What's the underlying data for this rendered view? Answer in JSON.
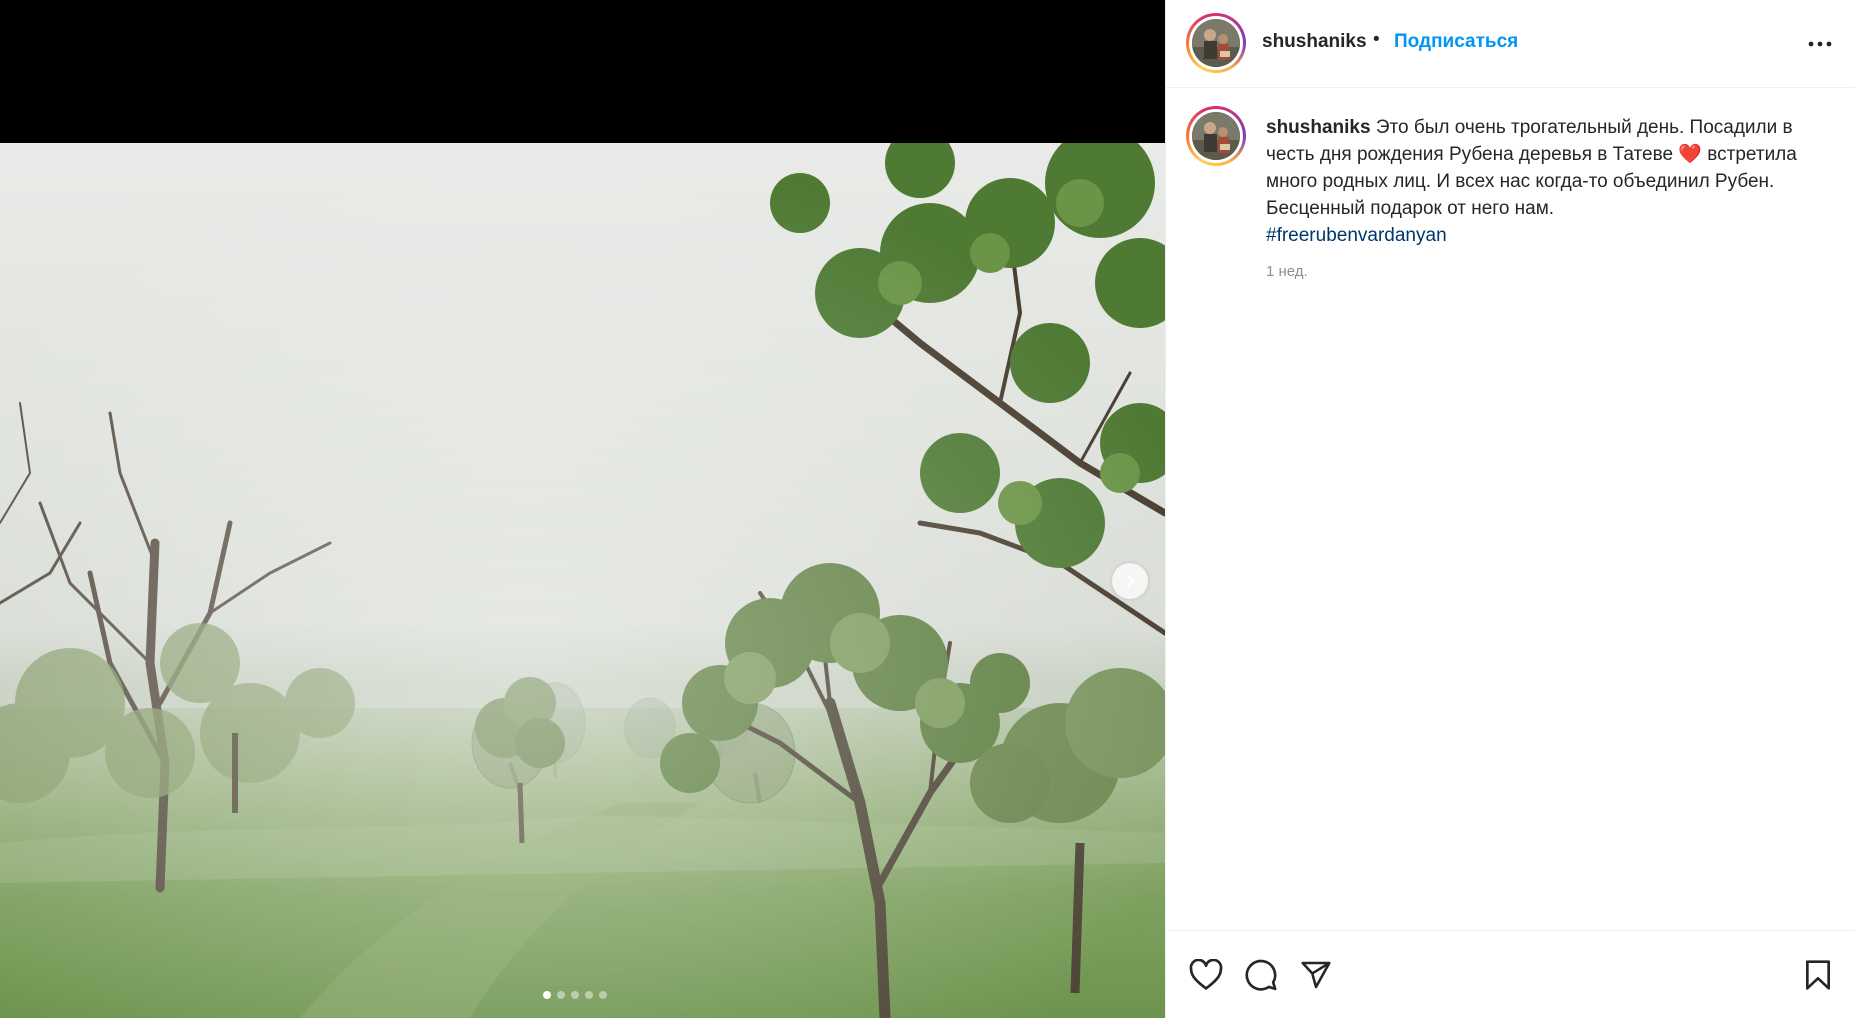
{
  "post": {
    "username": "shushaniks",
    "separator": "•",
    "follow_label": "Подписаться",
    "more_icon": "more-horizontal-icon",
    "caption_text": "Это был очень трогательный день. Посадили в честь дня рождения Рубена деревья в Татеве ",
    "caption_emoji": "❤️",
    "caption_text_2": " встретила много родных лиц. И всех нас когда-то объединил Рубен. Бесценный подарок от него нам.",
    "hashtag": "#freerubenvardanyan",
    "time": "1 нед."
  },
  "carousel": {
    "current": 1,
    "total": 5,
    "next_icon": "chevron-right-icon"
  },
  "actions": {
    "like_icon": "heart-icon",
    "comment_icon": "comment-icon",
    "share_icon": "send-icon",
    "save_icon": "bookmark-icon"
  },
  "colors": {
    "link": "#0095f6",
    "hashtag": "#00376b",
    "muted": "#8e8e8e",
    "text": "#262626"
  }
}
